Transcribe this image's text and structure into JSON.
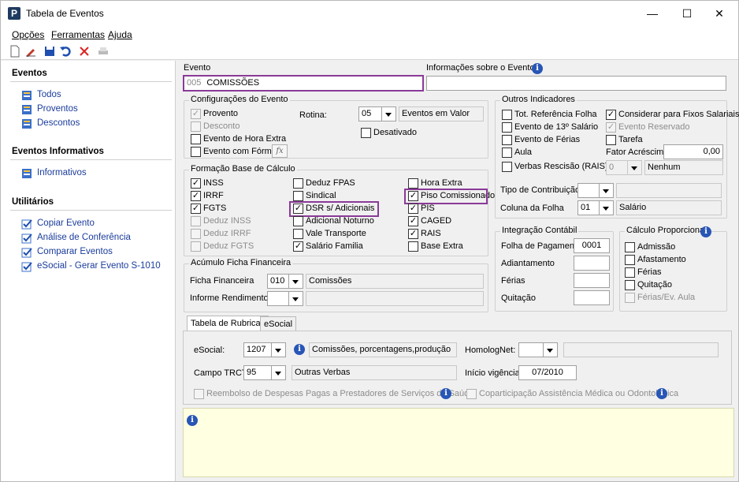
{
  "window": {
    "title": "Tabela de Eventos",
    "app_icon": "P",
    "minimize": "—",
    "maximize": "☐",
    "close": "✕"
  },
  "menu": [
    "Opções",
    "Ferramentas",
    "Ajuda"
  ],
  "sidebar": {
    "sections": [
      {
        "title": "Eventos",
        "items": [
          "Todos",
          "Proventos",
          "Descontos"
        ]
      },
      {
        "title": "Eventos Informativos",
        "items": [
          "Informativos"
        ]
      },
      {
        "title": "Utilitários",
        "items": [
          "Copiar Evento",
          "Análise de Conferência",
          "Comparar Eventos",
          "eSocial - Gerar Evento S-1010"
        ]
      }
    ]
  },
  "evento": {
    "label": "Evento",
    "code": "005",
    "name": "COMISSÕES",
    "info_label": "Informações sobre o Evento",
    "info_value": ""
  },
  "config": {
    "title": "Configurações do Evento",
    "provento": "Provento",
    "desconto": "Desconto",
    "hora_extra": "Evento de Hora Extra",
    "formula": "Evento com Fórmula",
    "formula_icon": "fx",
    "rotina_label": "Rotina:",
    "rotina_code": "05",
    "rotina_value": "Eventos em Valor",
    "desativado": "Desativado"
  },
  "base": {
    "title": "Formação Base de Cálculo",
    "col1": [
      "INSS",
      "IRRF",
      "FGTS",
      "Deduz INSS",
      "Deduz IRRF",
      "Deduz FGTS"
    ],
    "col2": [
      "Deduz FPAS",
      "Sindical",
      "DSR s/ Adicionais",
      "Adicional Noturno",
      "Vale Transporte",
      "Salário Familia"
    ],
    "col3": [
      "Hora Extra",
      "Piso Comissionado",
      "PIS",
      "CAGED",
      "RAIS",
      "Base Extra"
    ]
  },
  "acumulo": {
    "title": "Acúmulo Ficha Financeira",
    "ficha_label": "Ficha Financeira",
    "ficha_code": "010",
    "ficha_value": "Comissões",
    "informe_label": "Informe Rendimentos",
    "informe_code": "",
    "informe_value": ""
  },
  "outros": {
    "title": "Outros Indicadores",
    "tot_ref": "Tot. Referência Folha",
    "considerar": "Considerar para Fixos Salariais",
    "decimo": "Evento de 13º Salário",
    "reservado": "Evento Reservado",
    "ferias": "Evento de Férias",
    "tarefa": "Tarefa",
    "aula": "Aula",
    "fator_label": "Fator Acréscimo",
    "fator_value": "0,00",
    "verbas": "Verbas Rescisão (RAIS)",
    "verbas_code": "0",
    "verbas_value": "Nenhum",
    "tipo_label": "Tipo de Contribuição",
    "tipo_code": "",
    "tipo_value": "",
    "coluna_label": "Coluna da Folha",
    "coluna_code": "01",
    "coluna_value": "Salário"
  },
  "integracao": {
    "title": "Integração Contábil",
    "folha_label": "Folha de Pagamento",
    "folha_value": "0001",
    "adiantamento": "Adiantamento",
    "ferias": "Férias",
    "quitacao": "Quitação"
  },
  "proporcional": {
    "title": "Cálculo Proporcional",
    "items": [
      "Admissão",
      "Afastamento",
      "Férias",
      "Quitação",
      "Férias/Ev. Aula"
    ]
  },
  "tabs": [
    "Tabela de Rubricas",
    "eSocial"
  ],
  "rubricas": {
    "esocial_label": "eSocial:",
    "esocial_code": "1207",
    "esocial_value": "Comissões, porcentagens,produção",
    "homolog_label": "HomologNet:",
    "homolog_code": "",
    "homolog_value": "",
    "trct_label": "Campo TRCT:",
    "trct_code": "95",
    "trct_value": "Outras Verbas",
    "inicio_label": "Início vigência:",
    "inicio_value": "07/2010",
    "reembolso": "Reembolso de Despesas Pagas a Prestadores de Serviços de Saúde",
    "coparticipacao": "Coparticipação Assistência Médica ou Odontológica"
  },
  "colors": {
    "highlight": "#8a3a98",
    "link": "#1a3c9c",
    "note_bg": "#ffffe1",
    "info_blue": "#2856b6"
  },
  "icons": {
    "info": "i",
    "check": "✓"
  }
}
